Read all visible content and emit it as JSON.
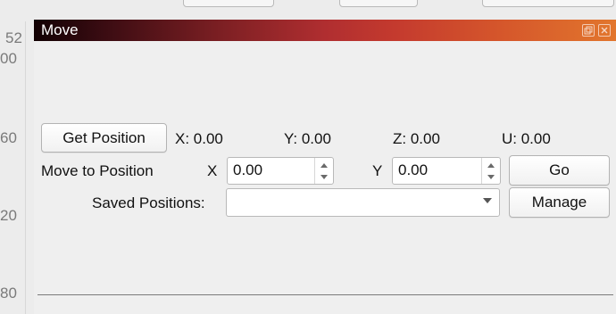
{
  "background": {
    "axis_labels": [
      "52",
      "00",
      "60",
      "20",
      "80"
    ]
  },
  "dock": {
    "title": "Move",
    "title_buttons": {
      "float_icon": "float-icon",
      "close_icon": "close-icon"
    }
  },
  "get_position": {
    "button_label": "Get Position",
    "x_readout": "X: 0.00",
    "y_readout": "Y: 0.00",
    "z_readout": "Z: 0.00",
    "u_readout": "U: 0.00"
  },
  "move_to": {
    "label": "Move to Position",
    "x_label": "X",
    "x_value": "0.00",
    "y_label": "Y",
    "y_value": "0.00",
    "go_label": "Go"
  },
  "saved": {
    "label": "Saved Positions:",
    "selected": "",
    "manage_label": "Manage"
  },
  "colors": {
    "title_gradient_start": "#120103",
    "title_gradient_mid": "#c43a2e",
    "title_gradient_end": "#e2762d"
  }
}
